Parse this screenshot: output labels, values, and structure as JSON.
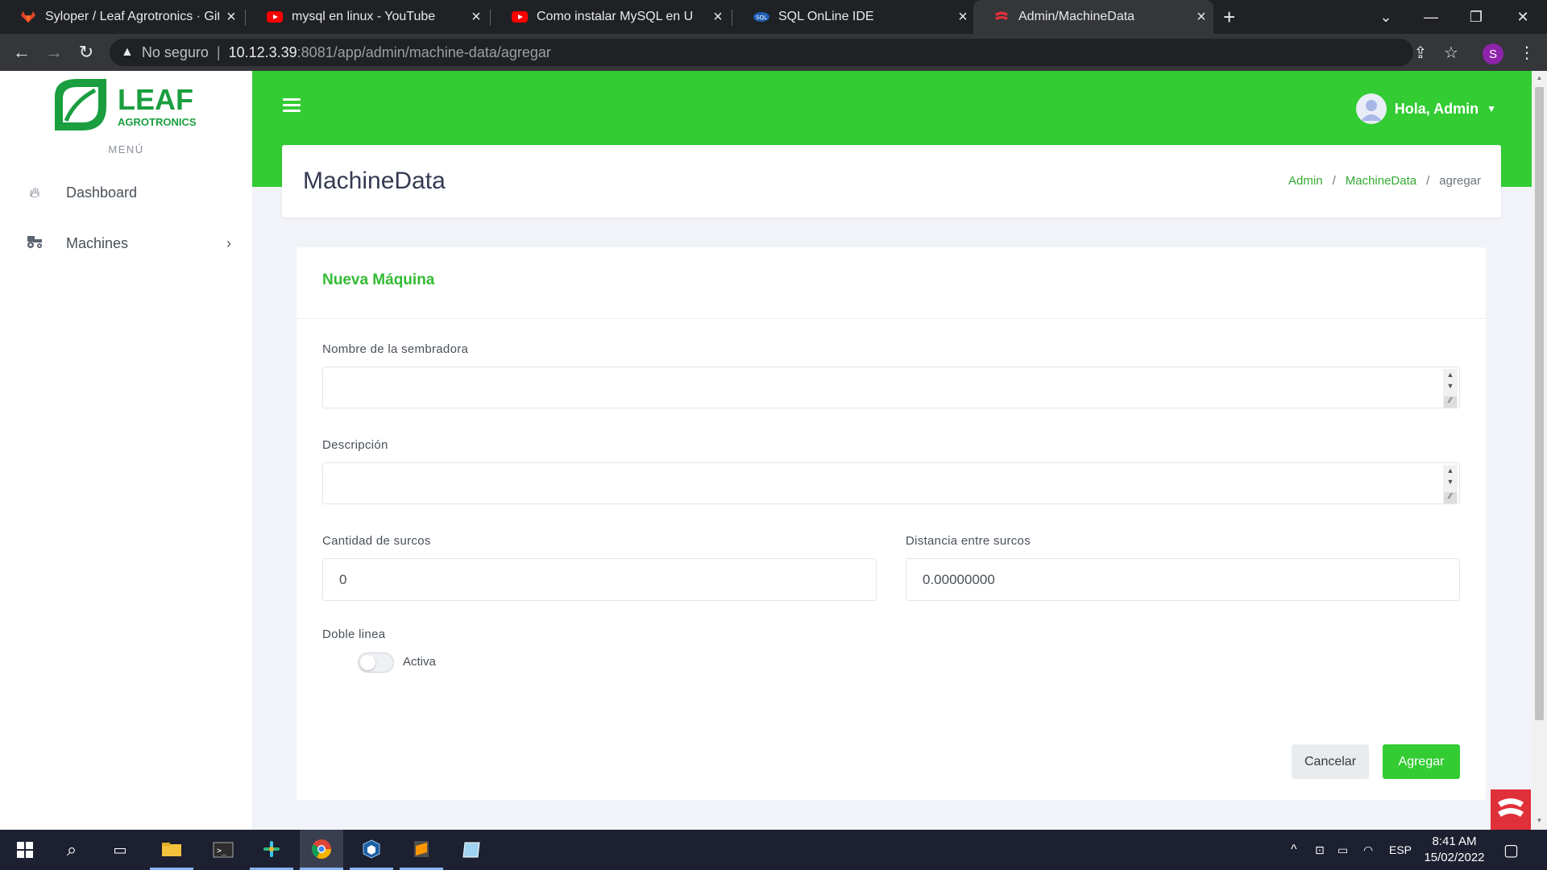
{
  "browser": {
    "tabs": [
      {
        "title": "Syloper / Leaf Agrotronics · GitLa",
        "icon": "gitlab-icon",
        "active": false
      },
      {
        "title": "mysql en linux - YouTube",
        "icon": "youtube-icon",
        "active": false
      },
      {
        "title": "Como instalar MySQL en U",
        "icon": "youtube-icon",
        "active": false
      },
      {
        "title": "SQL OnLine IDE",
        "icon": "sql-icon",
        "active": false
      },
      {
        "title": "Admin/MachineData",
        "icon": "admin-favicon-icon",
        "active": true
      }
    ],
    "security_label": "No seguro",
    "url_host": "10.12.3.39",
    "url_path": ":8081/app/admin/machine-data/agregar",
    "profile_initial": "S"
  },
  "sidebar": {
    "logo_word": "LEAF",
    "logo_sub": "AGROTRONICS",
    "menu_label": "MENÚ",
    "items": [
      {
        "label": "Dashboard",
        "icon": "fire-icon"
      },
      {
        "label": "Machines",
        "icon": "tractor-icon"
      }
    ]
  },
  "topbar": {
    "greeting": "Hola, Admin"
  },
  "page": {
    "title": "MachineData",
    "breadcrumb": [
      "Admin",
      "MachineData",
      "agregar"
    ]
  },
  "form": {
    "card_title": "Nueva Máquina",
    "fields": {
      "nombre_label": "Nombre de la sembradora",
      "nombre_value": "",
      "descripcion_label": "Descripción",
      "descripcion_value": "",
      "cantidad_label": "Cantidad de surcos",
      "cantidad_value": "0",
      "distancia_label": "Distancia entre surcos",
      "distancia_value": "0.00000000",
      "doble_label": "Doble linea",
      "toggle_label": "Activa",
      "toggle_on": false
    },
    "cancel_label": "Cancelar",
    "submit_label": "Agregar"
  },
  "taskbar": {
    "language": "ESP",
    "time": "8:41 AM",
    "date": "15/02/2022"
  },
  "colors": {
    "brand_green": "#33cc33",
    "link_green": "#33aa33"
  }
}
